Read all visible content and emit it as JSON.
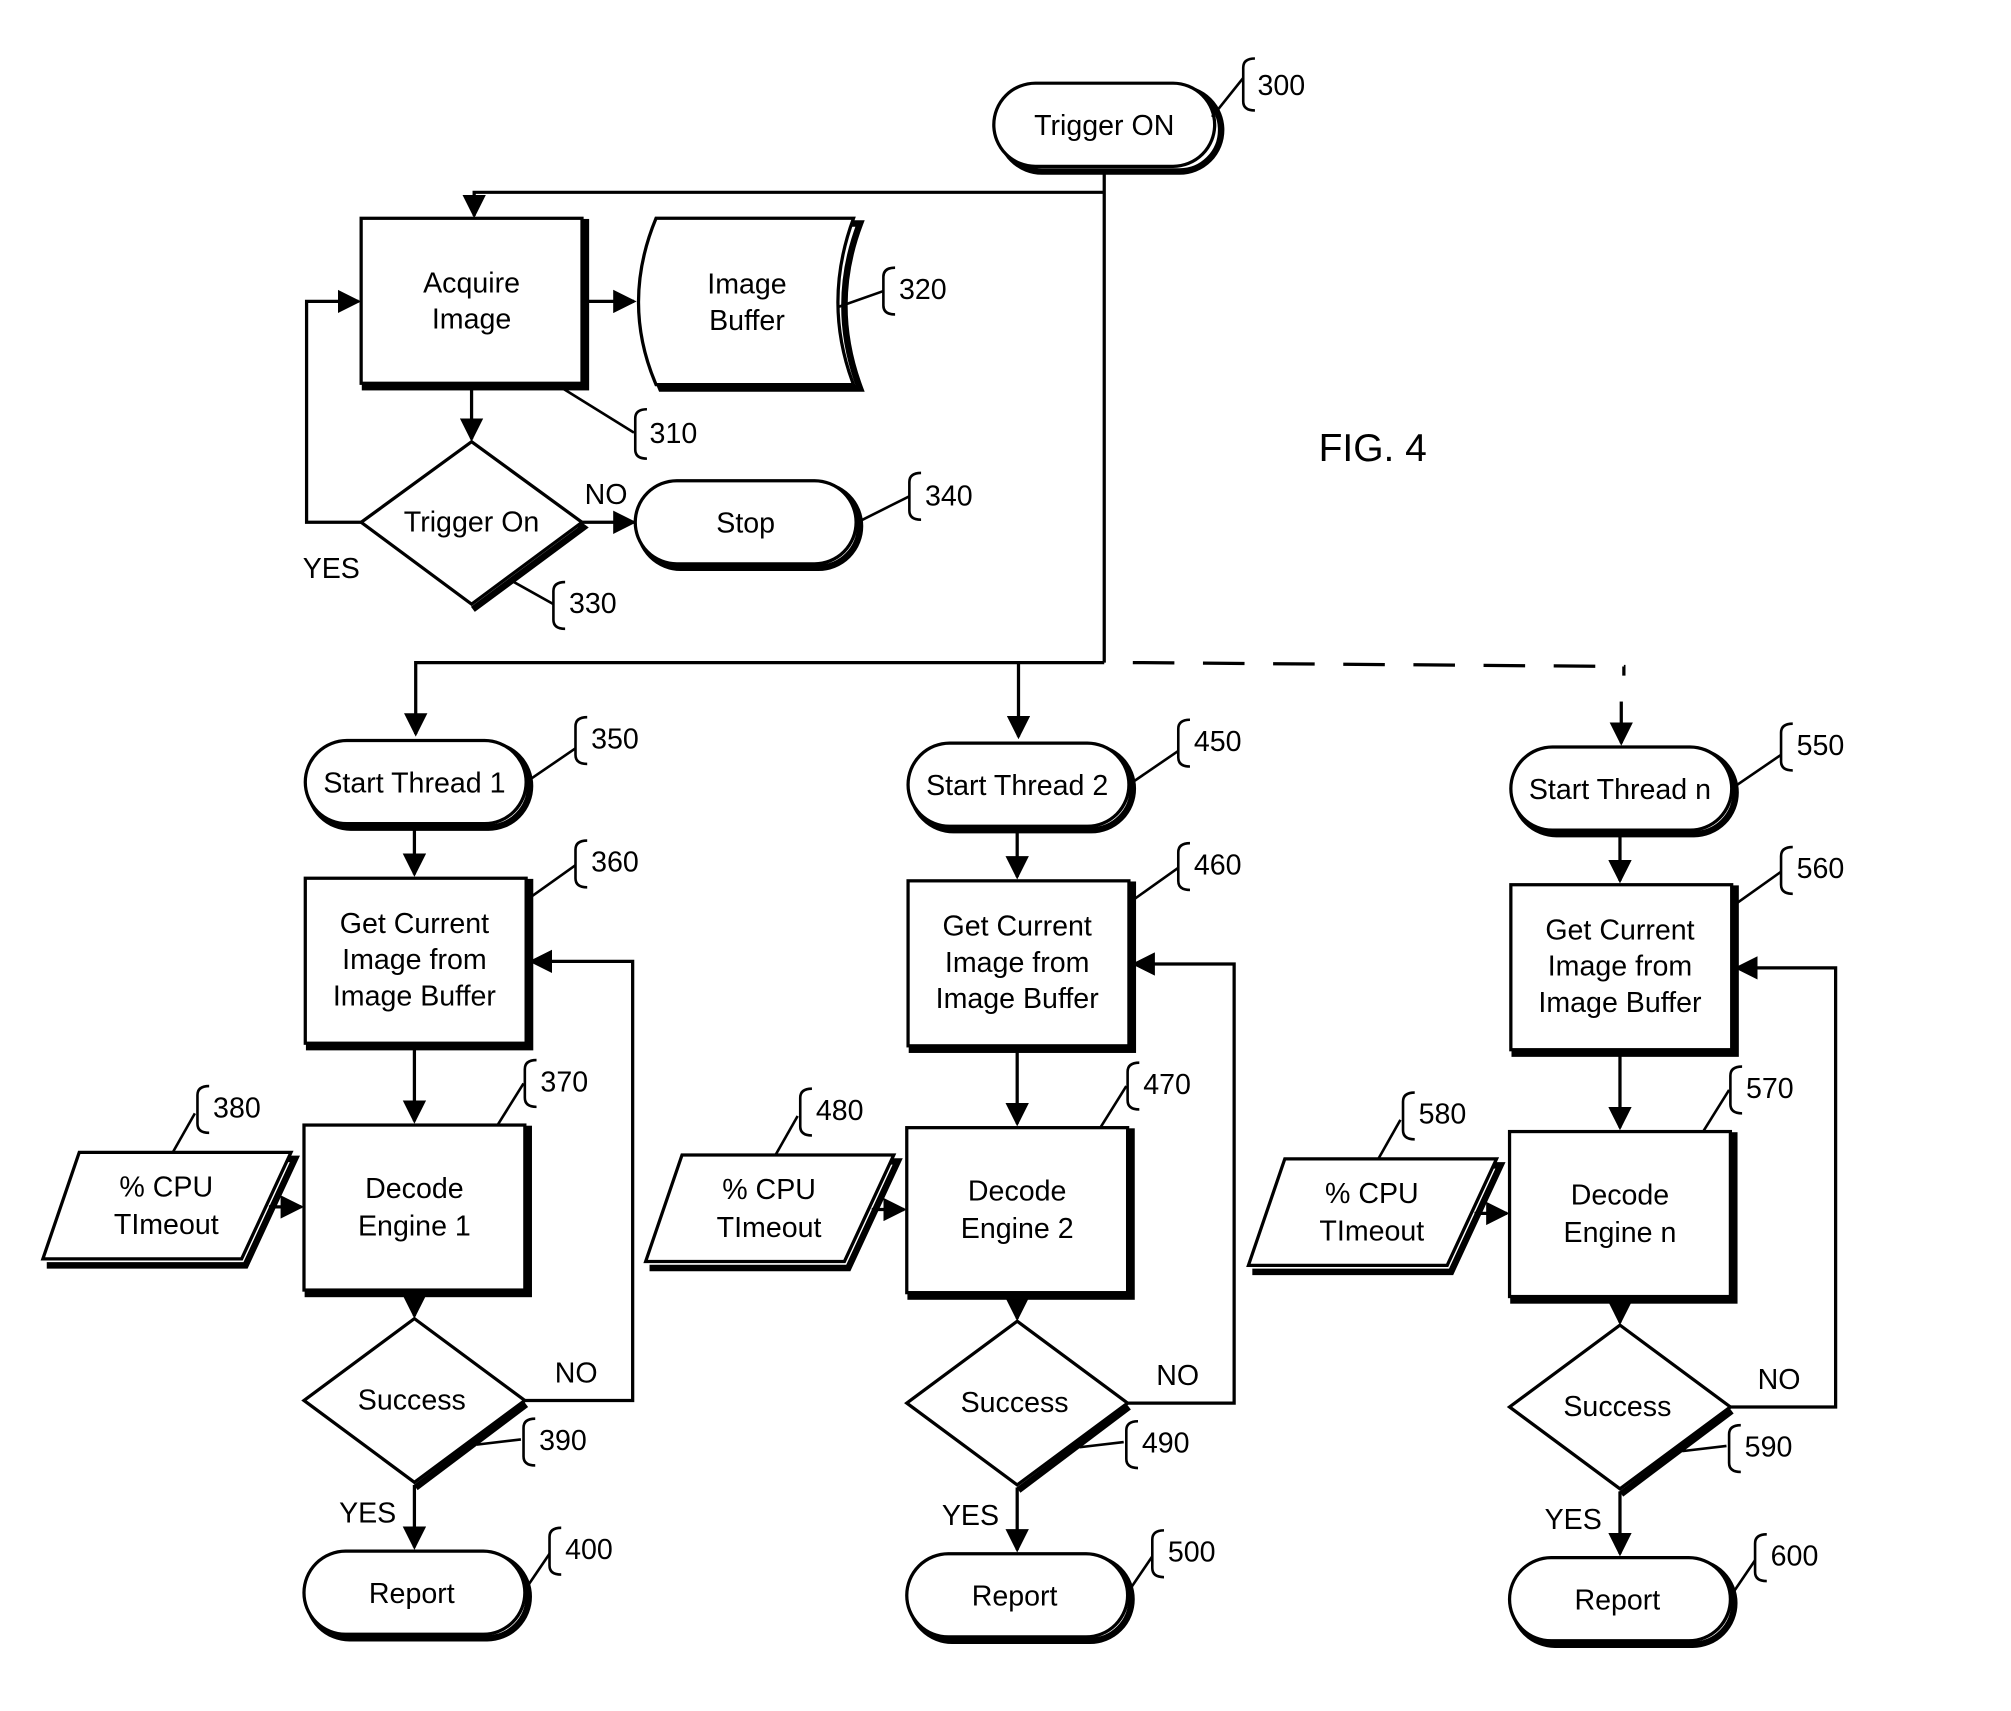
{
  "figure_label": "FIG. 4",
  "colors": {
    "stroke": "#000000",
    "background": "#ffffff"
  },
  "nodes": {
    "trigger_on": {
      "text": "Trigger ON",
      "ref": "300",
      "shape": "terminator"
    },
    "acquire_image": {
      "lines": [
        "Acquire",
        "Image"
      ],
      "ref": "310",
      "shape": "process"
    },
    "image_buffer": {
      "lines": [
        "Image",
        "Buffer"
      ],
      "ref": "320",
      "shape": "stored-data"
    },
    "trigger_on_decision": {
      "text": "Trigger On",
      "ref": "330",
      "shape": "decision"
    },
    "stop": {
      "text": "Stop",
      "ref": "340",
      "shape": "terminator"
    }
  },
  "edge_labels": {
    "no": "NO",
    "yes": "YES"
  },
  "threads": [
    {
      "start": {
        "text": "Start Thread 1",
        "ref": "350"
      },
      "get_image": {
        "lines": [
          "Get Current",
          "Image from",
          "Image Buffer"
        ],
        "ref": "360"
      },
      "decode": {
        "lines": [
          "Decode",
          "Engine 1"
        ],
        "ref": "370"
      },
      "input": {
        "lines": [
          "% CPU",
          "TImeout"
        ],
        "ref": "380"
      },
      "decision": {
        "text": "Success",
        "ref": "390"
      },
      "report": {
        "text": "Report",
        "ref": "400"
      }
    },
    {
      "start": {
        "text": "Start Thread 2",
        "ref": "450"
      },
      "get_image": {
        "lines": [
          "Get Current",
          "Image from",
          "Image Buffer"
        ],
        "ref": "460"
      },
      "decode": {
        "lines": [
          "Decode",
          "Engine 2"
        ],
        "ref": "470"
      },
      "input": {
        "lines": [
          "% CPU",
          "TImeout"
        ],
        "ref": "480"
      },
      "decision": {
        "text": "Success",
        "ref": "490"
      },
      "report": {
        "text": "Report",
        "ref": "500"
      }
    },
    {
      "start": {
        "text": "Start Thread n",
        "ref": "550"
      },
      "get_image": {
        "lines": [
          "Get Current",
          "Image from",
          "Image Buffer"
        ],
        "ref": "560"
      },
      "decode": {
        "lines": [
          "Decode",
          "Engine n"
        ],
        "ref": "570"
      },
      "input": {
        "lines": [
          "% CPU",
          "TImeout"
        ],
        "ref": "580"
      },
      "decision": {
        "text": "Success",
        "ref": "590"
      },
      "report": {
        "text": "Report",
        "ref": "600"
      }
    }
  ]
}
